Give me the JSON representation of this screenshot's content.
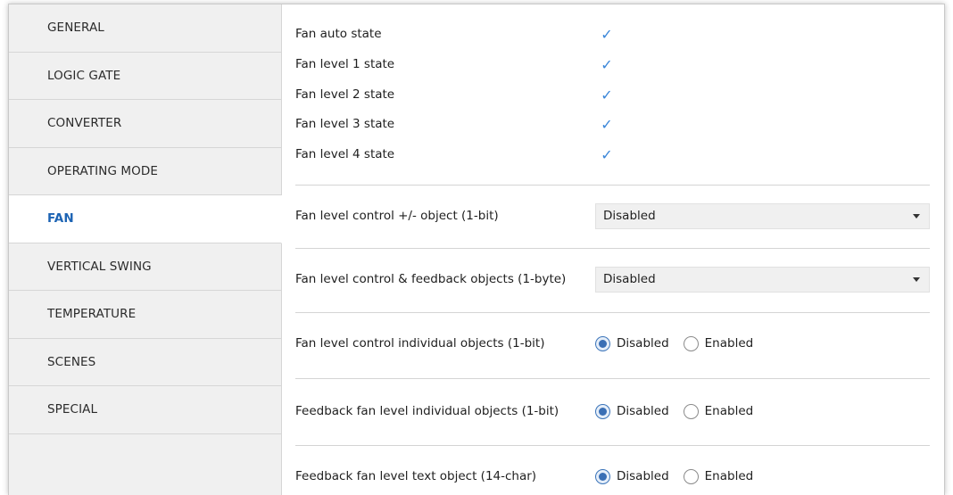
{
  "sidebar": {
    "items": [
      {
        "label": "GENERAL"
      },
      {
        "label": "LOGIC GATE"
      },
      {
        "label": "CONVERTER"
      },
      {
        "label": "OPERATING MODE"
      },
      {
        "label": "FAN",
        "active": true
      },
      {
        "label": "VERTICAL SWING"
      },
      {
        "label": "TEMPERATURE"
      },
      {
        "label": "SCENES"
      },
      {
        "label": "SPECIAL"
      }
    ]
  },
  "checkboxes": [
    {
      "label": "Fan auto state",
      "checked": true
    },
    {
      "label": "Fan level 1 state",
      "checked": true
    },
    {
      "label": "Fan level 2 state",
      "checked": true
    },
    {
      "label": "Fan level 3 state",
      "checked": true
    },
    {
      "label": "Fan level 4 state",
      "checked": true
    }
  ],
  "check_glyph": "✓",
  "dropdowns": [
    {
      "label": "Fan level control +/- object (1-bit)",
      "value": "Disabled"
    },
    {
      "label": "Fan level control & feedback objects (1-byte)",
      "value": "Disabled"
    }
  ],
  "radios": [
    {
      "label": "Fan level control individual objects (1-bit)",
      "options": [
        "Disabled",
        "Enabled"
      ],
      "selected": "Disabled"
    },
    {
      "label": "Feedback fan level individual objects (1-bit)",
      "options": [
        "Disabled",
        "Enabled"
      ],
      "selected": "Disabled"
    },
    {
      "label": "Feedback fan level text object (14-char)",
      "options": [
        "Disabled",
        "Enabled"
      ],
      "selected": "Disabled"
    }
  ],
  "colors": {
    "accent": "#1d64b4",
    "check": "#3a86d9",
    "sidebar_bg": "#f0f0f0"
  }
}
